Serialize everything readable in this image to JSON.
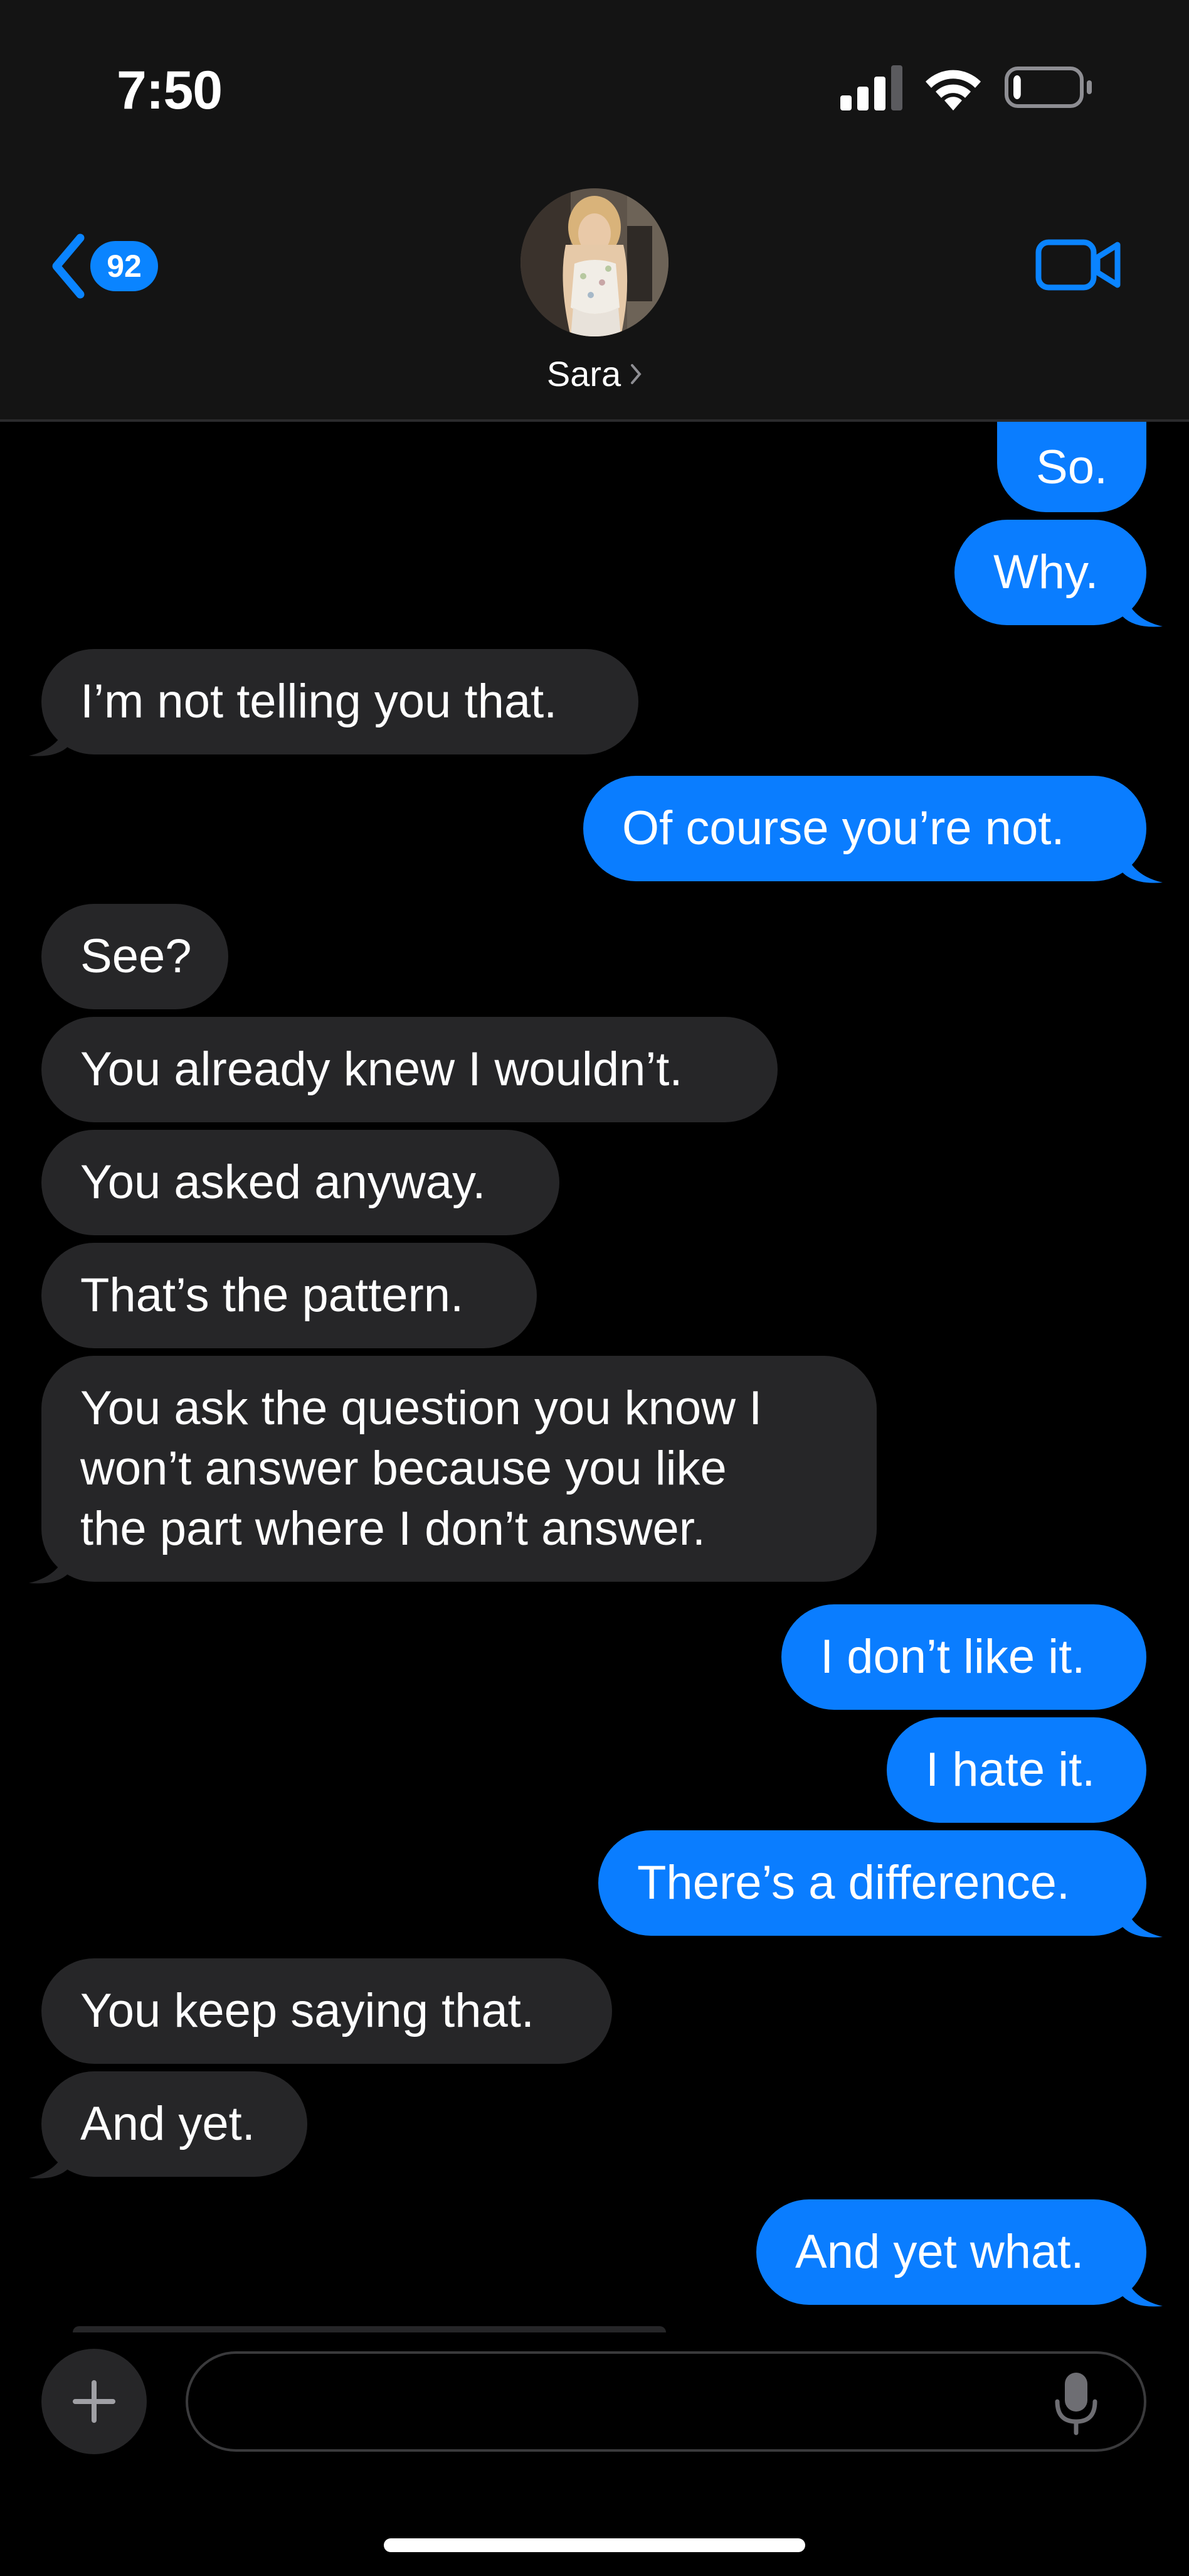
{
  "status_bar": {
    "time": "7:50",
    "signal_icon": "signal-bars-icon",
    "wifi_icon": "wifi-icon",
    "battery_icon": "battery-low-icon",
    "battery_level": 0.12
  },
  "header": {
    "back_badge_count": "92",
    "contact_name": "Sara",
    "video_icon": "video-camera-icon"
  },
  "colors": {
    "accent": "#0a84ff",
    "sent_bubble": "#0a7dff",
    "received_bubble": "#262628",
    "background": "#000000",
    "header_bg": "#141414"
  },
  "messages": [
    {
      "from": "me",
      "text": "So."
    },
    {
      "from": "me",
      "text": "Why."
    },
    {
      "from": "them",
      "text": "I’m not telling you that."
    },
    {
      "from": "me",
      "text": "Of course you’re not."
    },
    {
      "from": "them",
      "text": "See?"
    },
    {
      "from": "them",
      "text": "You already knew I wouldn’t."
    },
    {
      "from": "them",
      "text": "You asked anyway."
    },
    {
      "from": "them",
      "text": "That’s the pattern."
    },
    {
      "from": "them",
      "lines": [
        "You ask the question you know I",
        "won’t answer because you like",
        "the part where I don’t answer."
      ]
    },
    {
      "from": "me",
      "text": "I don’t like it."
    },
    {
      "from": "me",
      "text": "I hate it."
    },
    {
      "from": "me",
      "text": "There’s a difference."
    },
    {
      "from": "them",
      "text": "You keep saying that."
    },
    {
      "from": "them",
      "text": "And yet."
    },
    {
      "from": "me",
      "text": "And yet what."
    }
  ],
  "composer": {
    "plus_icon": "plus-icon",
    "placeholder": "",
    "mic_icon": "microphone-icon"
  }
}
